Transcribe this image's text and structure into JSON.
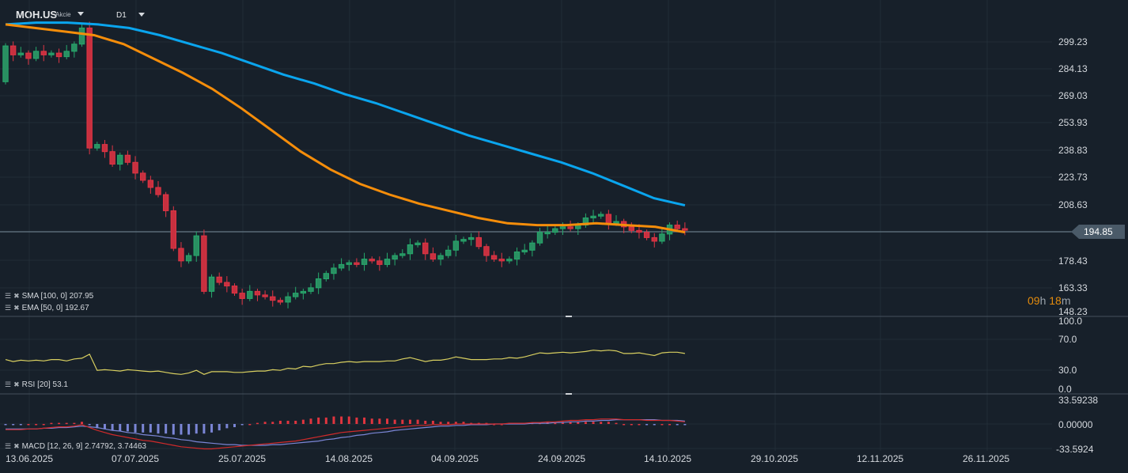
{
  "header": {
    "symbol": "MOH.US",
    "type": "Akcie",
    "timeframe": "D1"
  },
  "legends": {
    "sma": "SMA [100, 0] 207.95",
    "ema": "EMA [50, 0] 192.67",
    "rsi": "RSI [20] 53.1",
    "macd": "MACD [12, 26, 9] 2.74792, 3.74463"
  },
  "price_axis": [
    "299.23",
    "284.13",
    "269.03",
    "253.93",
    "238.83",
    "223.73",
    "208.63",
    "178.43",
    "163.33",
    "148.23"
  ],
  "current_price": "194.85",
  "timer": {
    "h": "09",
    "hu": "h",
    "m": "18",
    "mu": "m"
  },
  "rsi_axis": [
    "100.0",
    "70.0",
    "30.0",
    "0.0"
  ],
  "macd_axis": [
    "33.59238",
    "0.00000",
    "-33.5924"
  ],
  "x_axis": [
    "13.06.2025",
    "07.07.2025",
    "25.07.2025",
    "14.08.2025",
    "04.09.2025",
    "24.09.2025",
    "14.10.2025",
    "29.10.2025",
    "12.11.2025",
    "26.11.2025"
  ],
  "colors": {
    "up": "#26a96c",
    "down": "#e03545",
    "sma": "#0aa5ee",
    "ema": "#f58d0a",
    "rsi": "#d8cf60",
    "macd": "#d02a2a",
    "signal": "#7b86d6"
  },
  "chart_data": {
    "type": "candlestick",
    "first_open": 277,
    "close": [
      297,
      292,
      293,
      290,
      294,
      292,
      293,
      291,
      294,
      298,
      307,
      240,
      242,
      238,
      231,
      236,
      232,
      226,
      222,
      218,
      214,
      205,
      184,
      177,
      180,
      191,
      160,
      168,
      165,
      163,
      159,
      156,
      160,
      158,
      157,
      155,
      154,
      157,
      159,
      160,
      162,
      167,
      170,
      173,
      175,
      176,
      175,
      178,
      177,
      175,
      178,
      180,
      181,
      186,
      187,
      181,
      178,
      180,
      183,
      188,
      189,
      190,
      185,
      180,
      178,
      177,
      178,
      182,
      183,
      187,
      193,
      193,
      195,
      196,
      195,
      197,
      201,
      202,
      203,
      198,
      199,
      196,
      194,
      193,
      190,
      188,
      192,
      197,
      195,
      194.85
    ],
    "sma": [
      309,
      310,
      310,
      309,
      307,
      303,
      298,
      293,
      287,
      281,
      276,
      270,
      265,
      259,
      253,
      247,
      242,
      237,
      232,
      226,
      219,
      212,
      208
    ],
    "ema": [
      309,
      307,
      305,
      303,
      298,
      290,
      282,
      273,
      262,
      250,
      238,
      228,
      220,
      214,
      209,
      205,
      201,
      198,
      197,
      197,
      198,
      197,
      196,
      193
    ],
    "rsi": [
      44,
      41,
      43,
      42,
      43,
      42,
      44,
      44,
      42,
      45,
      46,
      52,
      28,
      29,
      28,
      27,
      29,
      28,
      27,
      26,
      27,
      25,
      23,
      22,
      24,
      28,
      22,
      26,
      26,
      26,
      25,
      25,
      26,
      27,
      27,
      29,
      28,
      31,
      30,
      34,
      33,
      36,
      38,
      38,
      40,
      41,
      40,
      41,
      41,
      41,
      42,
      42,
      45,
      47,
      44,
      41,
      43,
      43,
      45,
      48,
      46,
      44,
      44,
      44,
      45,
      45,
      47,
      46,
      48,
      51,
      54,
      53,
      54,
      55,
      54,
      55,
      56,
      58,
      57,
      58,
      57,
      53,
      53,
      54,
      52,
      50,
      54,
      55,
      55,
      53
    ],
    "macd": [
      -8,
      -8,
      -8,
      -7,
      -7,
      -6,
      -5,
      -4,
      -4,
      -3,
      -1,
      -5,
      -9,
      -12,
      -15,
      -17,
      -19,
      -21,
      -23,
      -24,
      -26,
      -28,
      -30,
      -32,
      -33,
      -34,
      -35,
      -35,
      -34,
      -33,
      -32,
      -31,
      -30,
      -29,
      -28,
      -27,
      -26,
      -25,
      -24,
      -22,
      -20,
      -18,
      -16,
      -14,
      -12,
      -11,
      -10,
      -9,
      -8,
      -7,
      -6,
      -5,
      -4,
      -3,
      -2,
      -2,
      -1,
      -1,
      -1,
      0,
      0,
      0,
      0,
      0,
      0,
      0,
      1,
      1,
      1,
      2,
      2,
      3,
      3,
      4,
      5,
      5,
      6,
      6,
      7,
      7,
      7,
      6,
      6,
      6,
      5,
      5,
      5,
      5,
      4,
      3
    ],
    "signal": [
      -7,
      -7,
      -7,
      -7,
      -7,
      -6,
      -6,
      -5,
      -5,
      -4,
      -3,
      -4,
      -5,
      -7,
      -9,
      -10,
      -12,
      -13,
      -15,
      -16,
      -17,
      -19,
      -20,
      -22,
      -23,
      -25,
      -26,
      -27,
      -28,
      -29,
      -29,
      -30,
      -30,
      -30,
      -30,
      -29,
      -29,
      -28,
      -27,
      -26,
      -25,
      -24,
      -22,
      -21,
      -19,
      -18,
      -16,
      -15,
      -13,
      -12,
      -11,
      -9,
      -8,
      -7,
      -6,
      -5,
      -4,
      -3,
      -3,
      -2,
      -2,
      -1,
      -1,
      -1,
      0,
      0,
      0,
      0,
      0,
      1,
      1,
      1,
      2,
      2,
      3,
      3,
      4,
      4,
      5,
      5,
      6,
      6,
      6,
      6,
      6,
      6,
      5,
      5,
      5,
      4
    ]
  }
}
